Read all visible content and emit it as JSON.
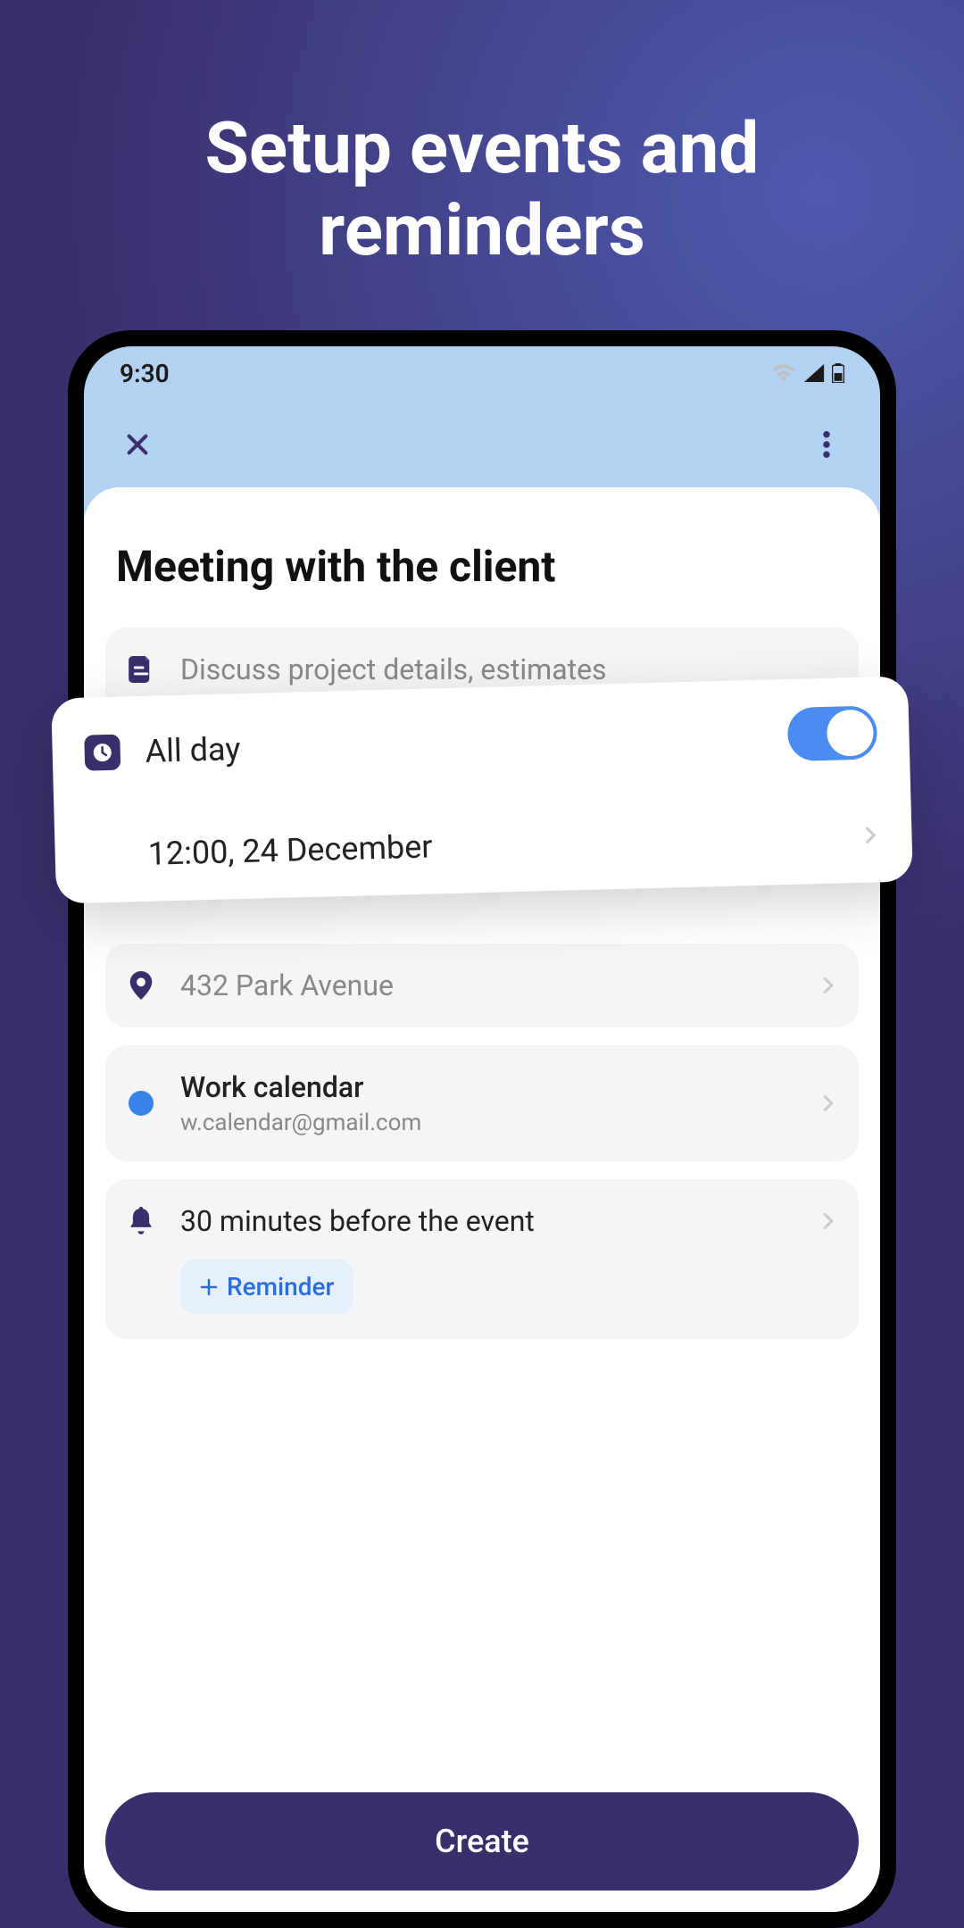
{
  "promo": {
    "title": "Setup events and reminders"
  },
  "status": {
    "time": "9:30"
  },
  "event": {
    "title": "Meeting with the client",
    "description_placeholder": "Discuss project details, estimates",
    "all_day_label": "All day",
    "all_day_enabled": true,
    "datetime": "12:00,  24 December",
    "location": "432 Park Avenue",
    "calendar_name": "Work calendar",
    "calendar_email": "w.calendar@gmail.com",
    "reminder_text": "30 minutes before the event",
    "add_reminder_label": "Reminder",
    "create_label": "Create"
  },
  "colors": {
    "accent": "#3a2e6b",
    "toggle_on": "#4a8cf0",
    "link_blue": "#2a6de0"
  }
}
